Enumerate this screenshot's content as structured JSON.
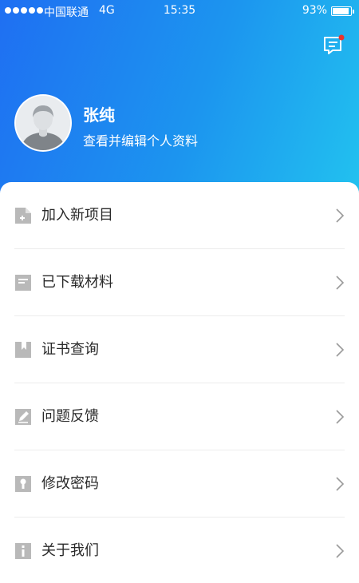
{
  "status_bar": {
    "carrier": "中国联通",
    "network": "4G",
    "time": "15:35",
    "battery_text": "93%",
    "battery_level": 0.93
  },
  "header": {
    "message_icon": "message-icon",
    "has_unread": true
  },
  "profile": {
    "name": "张纯",
    "subtitle": "查看并编辑个人资料",
    "avatar_icon": "default-avatar"
  },
  "menu": [
    {
      "label": "加入新项目",
      "icon": "add-document-icon"
    },
    {
      "label": "已下载材料",
      "icon": "document-icon"
    },
    {
      "label": "证书查询",
      "icon": "certificate-icon"
    },
    {
      "label": "问题反馈",
      "icon": "edit-icon"
    },
    {
      "label": "修改密码",
      "icon": "lock-icon"
    },
    {
      "label": "关于我们",
      "icon": "info-icon"
    }
  ],
  "colors": {
    "header_start": "#1f6ff2",
    "header_end": "#22c2ef",
    "icon_gray": "#b9b9b9",
    "badge_red": "#e8332c"
  }
}
